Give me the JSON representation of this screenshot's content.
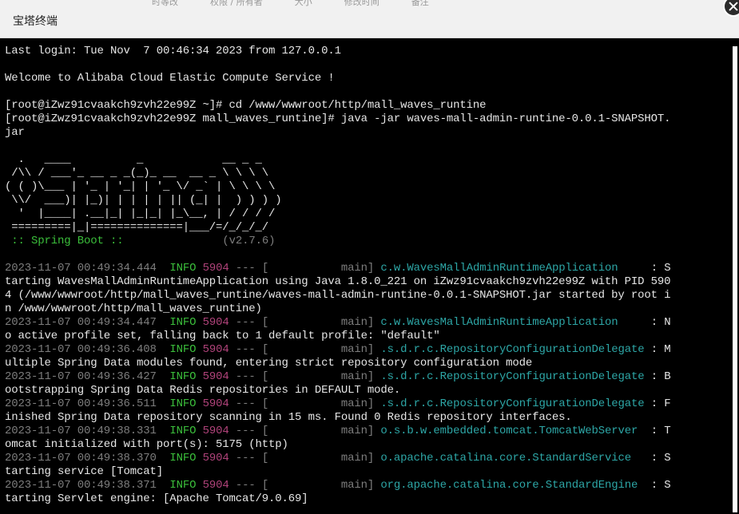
{
  "window": {
    "title": "宝塔终端",
    "ghost_headers": [
      "时等改",
      "权限 / 所有者",
      "大小",
      "修改时间",
      "备注"
    ]
  },
  "terminal": {
    "login": "Last login: Tue Nov  7 00:46:34 2023 from 127.0.0.1",
    "welcome": "Welcome to Alibaba Cloud Elastic Compute Service !",
    "cmd1": "[root@iZwz91cvaakch9zvh22e99Z ~]# cd /www/wwwroot/http/mall_waves_runtine",
    "cmd2a": "[root@iZwz91cvaakch9zvh22e99Z mall_waves_runtine]# java -jar waves-mall-admin-runtine-0.0.1-SNAPSHOT.",
    "cmd2b": "jar",
    "banner": [
      "  .   ____          _            __ _ _",
      " /\\\\ / ___'_ __ _ _(_)_ __  __ _ \\ \\ \\ \\",
      "( ( )\\___ | '_ | '_| | '_ \\/ _` | \\ \\ \\ \\",
      " \\\\/  ___)| |_)| | | | | || (_| |  ) ) ) )",
      "  '  |____| .__|_| |_|_| |_\\__, | / / / /",
      " =========|_|==============|___/=/_/_/_/"
    ],
    "spring_boot_label": " :: Spring Boot ::",
    "spring_version": "(v2.7.6)",
    "logs": [
      {
        "ts": "2023-11-07 00:49:34.444",
        "level": "INFO",
        "pid": "5904",
        "thread": "main",
        "logger": "c.w.WavesMallAdminRuntimeApplication    ",
        "msg1": ": S",
        "cont": [
          "tarting WavesMallAdminRuntimeApplication using Java 1.8.0_221 on iZwz91cvaakch9zvh22e99Z with PID 590",
          "4 (/www/wwwroot/http/mall_waves_runtine/waves-mall-admin-runtine-0.0.1-SNAPSHOT.jar started by root i",
          "n /www/wwwroot/http/mall_waves_runtine)"
        ]
      },
      {
        "ts": "2023-11-07 00:49:34.447",
        "level": "INFO",
        "pid": "5904",
        "thread": "main",
        "logger": "c.w.WavesMallAdminRuntimeApplication    ",
        "msg1": ": N",
        "cont": [
          "o active profile set, falling back to 1 default profile: \"default\""
        ]
      },
      {
        "ts": "2023-11-07 00:49:36.408",
        "level": "INFO",
        "pid": "5904",
        "thread": "main",
        "logger": ".s.d.r.c.RepositoryConfigurationDelegate",
        "msg1": ": M",
        "cont": [
          "ultiple Spring Data modules found, entering strict repository configuration mode"
        ]
      },
      {
        "ts": "2023-11-07 00:49:36.427",
        "level": "INFO",
        "pid": "5904",
        "thread": "main",
        "logger": ".s.d.r.c.RepositoryConfigurationDelegate",
        "msg1": ": B",
        "cont": [
          "ootstrapping Spring Data Redis repositories in DEFAULT mode."
        ]
      },
      {
        "ts": "2023-11-07 00:49:36.511",
        "level": "INFO",
        "pid": "5904",
        "thread": "main",
        "logger": ".s.d.r.c.RepositoryConfigurationDelegate",
        "msg1": ": F",
        "cont": [
          "inished Spring Data repository scanning in 15 ms. Found 0 Redis repository interfaces."
        ]
      },
      {
        "ts": "2023-11-07 00:49:38.331",
        "level": "INFO",
        "pid": "5904",
        "thread": "main",
        "logger": "o.s.b.w.embedded.tomcat.TomcatWebServer ",
        "msg1": ": T",
        "cont": [
          "omcat initialized with port(s): 5175 (http)"
        ]
      },
      {
        "ts": "2023-11-07 00:49:38.370",
        "level": "INFO",
        "pid": "5904",
        "thread": "main",
        "logger": "o.apache.catalina.core.StandardService  ",
        "msg1": ": S",
        "cont": [
          "tarting service [Tomcat]"
        ]
      },
      {
        "ts": "2023-11-07 00:49:38.371",
        "level": "INFO",
        "pid": "5904",
        "thread": "main",
        "logger": "org.apache.catalina.core.StandardEngine ",
        "msg1": ": S",
        "cont": [
          "tarting Servlet engine: [Apache Tomcat/9.0.69]"
        ]
      }
    ]
  }
}
